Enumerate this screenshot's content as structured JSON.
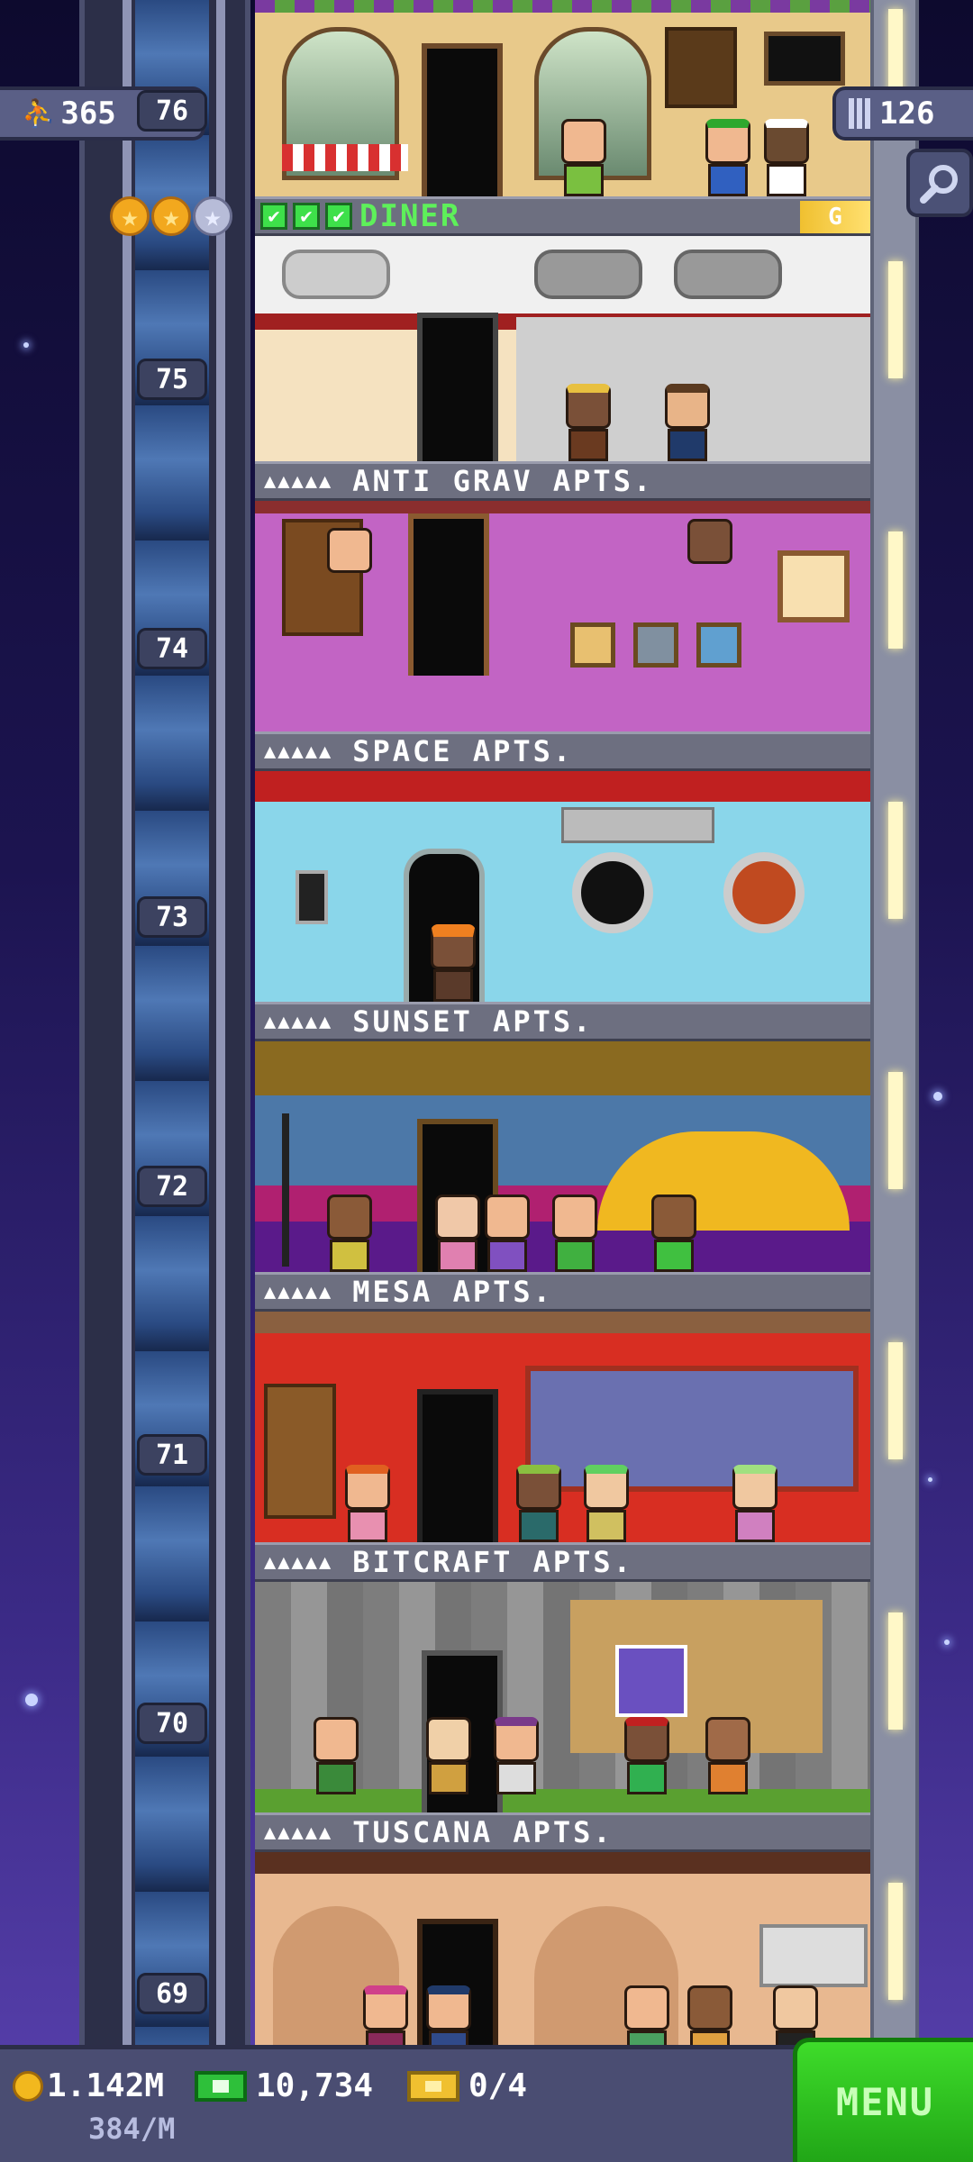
{
  "hud": {
    "population": "365",
    "current_floor": "76",
    "building_floors": "126"
  },
  "diner": {
    "name": "DINER",
    "rating_stars_filled": 2,
    "rating_stars_total": 3,
    "checks": 3,
    "badge": "G"
  },
  "floor_numbers": {
    "f75": "75",
    "f74": "74",
    "f73": "73",
    "f72": "72",
    "f71": "71",
    "f70": "70",
    "f69": "69"
  },
  "floors": [
    {
      "number": "75",
      "name": "ANTI GRAV APTS."
    },
    {
      "number": "74",
      "name": "SPACE APTS."
    },
    {
      "number": "73",
      "name": "SUNSET APTS."
    },
    {
      "number": "72",
      "name": "MESA APTS."
    },
    {
      "number": "71",
      "name": "BITCRAFT APTS."
    },
    {
      "number": "70",
      "name": "TUSCANA APTS."
    }
  ],
  "stars_label": "▲▲▲▲▲",
  "stats": {
    "coins": "1.142M",
    "coins_rate": "384/M",
    "bux": "10,734",
    "tickets": "0/4"
  },
  "menu_label": "MENU",
  "icons": {
    "population": "person-icon",
    "floors": "building-icon",
    "search": "magnifier-icon",
    "coins": "coin-icon",
    "bux": "bux-icon",
    "tickets": "ticket-icon"
  },
  "colors": {
    "menu_green": "#2ec82a",
    "label_gray": "#6d6f80",
    "diner_green": "#5ef05a"
  }
}
